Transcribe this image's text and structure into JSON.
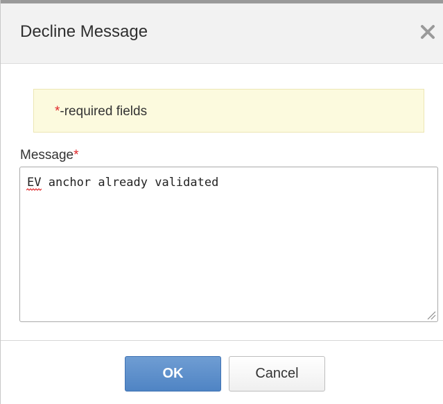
{
  "dialog": {
    "title": "Decline Message",
    "close_icon": "close-icon"
  },
  "notice": {
    "star": "*",
    "text": "-required fields",
    "background": "#fcfade"
  },
  "message_field": {
    "label": "Message",
    "required_mark": "*",
    "value": "EV anchor already validated"
  },
  "buttons": {
    "ok_label": "OK",
    "cancel_label": "Cancel"
  },
  "colors": {
    "accent": "#4f84c4",
    "required": "#e0272a"
  }
}
